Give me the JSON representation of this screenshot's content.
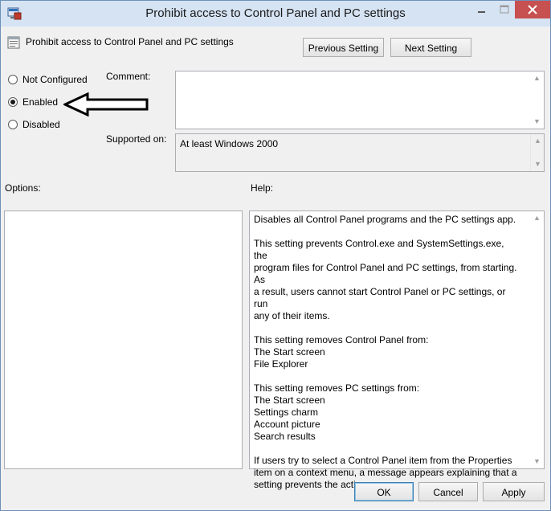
{
  "window": {
    "title": "Prohibit access to Control Panel and PC settings",
    "accent": "#d5e3f3",
    "close_color": "#c75050"
  },
  "setting": {
    "name": "Prohibit access to Control Panel and PC settings",
    "icon": "policy-setting-icon"
  },
  "nav": {
    "previous": "Previous Setting",
    "next": "Next Setting"
  },
  "state": {
    "options": [
      {
        "label": "Not Configured",
        "checked": false
      },
      {
        "label": "Enabled",
        "checked": true
      },
      {
        "label": "Disabled",
        "checked": false
      }
    ]
  },
  "comment": {
    "label": "Comment:",
    "value": ""
  },
  "supported": {
    "label": "Supported on:",
    "value": "At least Windows 2000"
  },
  "options_panel": {
    "label": "Options:"
  },
  "help": {
    "label": "Help:",
    "paragraphs": [
      [
        "Disables all Control Panel programs and the PC settings app."
      ],
      [
        "This setting prevents Control.exe and SystemSettings.exe, the",
        "program files for Control Panel and PC settings, from starting. As",
        "a result, users cannot start Control Panel or PC settings, or run",
        "any of their items."
      ],
      [
        "This setting removes Control Panel from:",
        "The Start screen",
        "File Explorer"
      ],
      [
        "This setting removes PC settings from:",
        "The Start screen",
        "Settings charm",
        "Account picture",
        "Search results"
      ],
      [
        "If users try to select a Control Panel item from the Properties",
        "item on a context menu, a message appears explaining that a",
        "setting prevents the action."
      ]
    ]
  },
  "footer": {
    "ok": "OK",
    "cancel": "Cancel",
    "apply": "Apply"
  }
}
